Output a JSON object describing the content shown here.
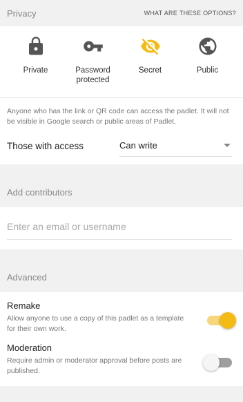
{
  "privacy": {
    "title": "Privacy",
    "help_link": "WHAT ARE THESE OPTIONS?",
    "options": [
      {
        "label": "Private",
        "icon": "lock-icon"
      },
      {
        "label": "Password protected",
        "icon": "key-icon"
      },
      {
        "label": "Secret",
        "icon": "eye-off-icon",
        "selected": true
      },
      {
        "label": "Public",
        "icon": "globe-icon"
      }
    ],
    "description": "Anyone who has the link or QR code can access the padlet. It will not be visible in Google search or public areas of Padlet.",
    "access_label": "Those with access",
    "access_value": "Can write"
  },
  "contributors": {
    "title": "Add contributors",
    "placeholder": "Enter an email or username"
  },
  "advanced": {
    "title": "Advanced",
    "remake": {
      "title": "Remake",
      "description": "Allow anyone to use a copy of this padlet as a template for their own work.",
      "enabled": true
    },
    "moderation": {
      "title": "Moderation",
      "description": "Require admin or moderator approval before posts are published.",
      "enabled": false
    }
  },
  "colors": {
    "accent": "#f5bb15",
    "icon_default": "#555555"
  }
}
